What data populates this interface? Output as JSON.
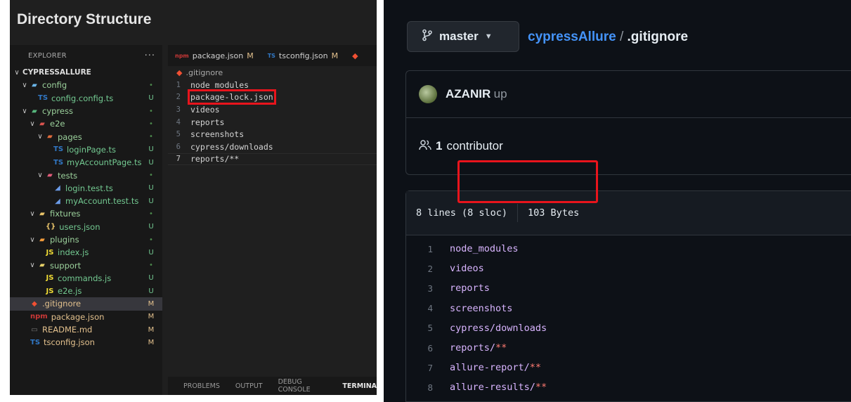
{
  "left": {
    "title": "Directory Structure",
    "explorer": {
      "header": "EXPLORER",
      "more": "···",
      "items": [
        {
          "name": "CYPRESSALLURE",
          "depth": 0,
          "chevron": "∨",
          "icon": "",
          "icon_name": "",
          "status": "",
          "kind": "root"
        },
        {
          "name": "config",
          "depth": 1,
          "chevron": "∨",
          "icon": "▰",
          "icon_name": "folder-config-icon",
          "status": "•",
          "kind": "folder"
        },
        {
          "name": "config.config.ts",
          "depth": 2,
          "chevron": "",
          "icon": "TS",
          "icon_name": "typescript-icon",
          "status": "U",
          "kind": "file"
        },
        {
          "name": "cypress",
          "depth": 1,
          "chevron": "∨",
          "icon": "▰",
          "icon_name": "folder-cypress-icon",
          "status": "•",
          "kind": "folder"
        },
        {
          "name": "e2e",
          "depth": 2,
          "chevron": "∨",
          "icon": "▰",
          "icon_name": "folder-e2e-icon",
          "status": "•",
          "kind": "folder"
        },
        {
          "name": "pages",
          "depth": 3,
          "chevron": "∨",
          "icon": "▰",
          "icon_name": "folder-pages-icon",
          "status": "•",
          "kind": "folder"
        },
        {
          "name": "loginPage.ts",
          "depth": 4,
          "chevron": "",
          "icon": "TS",
          "icon_name": "typescript-icon",
          "status": "U",
          "kind": "file"
        },
        {
          "name": "myAccountPage.ts",
          "depth": 4,
          "chevron": "",
          "icon": "TS",
          "icon_name": "typescript-icon",
          "status": "U",
          "kind": "file"
        },
        {
          "name": "tests",
          "depth": 3,
          "chevron": "∨",
          "icon": "▰",
          "icon_name": "folder-tests-icon",
          "status": "•",
          "kind": "folder"
        },
        {
          "name": "login.test.ts",
          "depth": 4,
          "chevron": "",
          "icon": "◢",
          "icon_name": "test-file-icon",
          "status": "U",
          "kind": "file"
        },
        {
          "name": "myAccount.test.ts",
          "depth": 4,
          "chevron": "",
          "icon": "◢",
          "icon_name": "test-file-icon",
          "status": "U",
          "kind": "file"
        },
        {
          "name": "fixtures",
          "depth": 2,
          "chevron": "∨",
          "icon": "▰",
          "icon_name": "folder-fixtures-icon",
          "status": "•",
          "kind": "folder"
        },
        {
          "name": "users.json",
          "depth": 3,
          "chevron": "",
          "icon": "{}",
          "icon_name": "json-icon",
          "status": "U",
          "kind": "file"
        },
        {
          "name": "plugins",
          "depth": 2,
          "chevron": "∨",
          "icon": "▰",
          "icon_name": "folder-plugins-icon",
          "status": "•",
          "kind": "folder"
        },
        {
          "name": "index.js",
          "depth": 3,
          "chevron": "",
          "icon": "JS",
          "icon_name": "javascript-icon",
          "status": "U",
          "kind": "file"
        },
        {
          "name": "support",
          "depth": 2,
          "chevron": "∨",
          "icon": "▰",
          "icon_name": "folder-support-icon",
          "status": "•",
          "kind": "folder"
        },
        {
          "name": "commands.js",
          "depth": 3,
          "chevron": "",
          "icon": "JS",
          "icon_name": "javascript-icon",
          "status": "U",
          "kind": "file"
        },
        {
          "name": "e2e.js",
          "depth": 3,
          "chevron": "",
          "icon": "JS",
          "icon_name": "javascript-icon",
          "status": "U",
          "kind": "file"
        },
        {
          "name": ".gitignore",
          "depth": 1,
          "chevron": "",
          "icon": "◆",
          "icon_name": "git-icon",
          "status": "M",
          "kind": "modified",
          "selected": true
        },
        {
          "name": "package.json",
          "depth": 1,
          "chevron": "",
          "icon": "npm",
          "icon_name": "npm-icon",
          "status": "M",
          "kind": "modified"
        },
        {
          "name": "README.md",
          "depth": 1,
          "chevron": "",
          "icon": "▭",
          "icon_name": "markdown-icon",
          "status": "M",
          "kind": "modified"
        },
        {
          "name": "tsconfig.json",
          "depth": 1,
          "chevron": "",
          "icon": "TS",
          "icon_name": "tsconfig-icon",
          "status": "M",
          "kind": "modified"
        }
      ]
    },
    "tabs": [
      {
        "label": "package.json",
        "status": "M",
        "icon": "npm",
        "icon_name": "npm-icon"
      },
      {
        "label": "tsconfig.json",
        "status": "M",
        "icon": "TS",
        "icon_name": "tsconfig-icon"
      }
    ],
    "breadcrumb": ".gitignore",
    "code_lines": [
      {
        "num": "1",
        "text": "node_modules"
      },
      {
        "num": "2",
        "text": "package-lock.json",
        "highlight": true
      },
      {
        "num": "3",
        "text": "videos"
      },
      {
        "num": "4",
        "text": "reports"
      },
      {
        "num": "5",
        "text": "screenshots"
      },
      {
        "num": "6",
        "text": "cypress/downloads"
      },
      {
        "num": "7",
        "text": "reports/**",
        "current": true
      }
    ],
    "panel_tabs": [
      "PROBLEMS",
      "OUTPUT",
      "DEBUG CONSOLE",
      "TERMINA"
    ]
  },
  "right": {
    "branch": "master",
    "repo": "cypressAllure",
    "separator": "/",
    "file": ".gitignore",
    "commit_author": "AZANIR",
    "commit_message": "up",
    "contributors_count": "1",
    "contributors_label": "contributor",
    "file_lines_info": "8 lines (8 sloc)",
    "file_size": "103 Bytes",
    "lines": [
      {
        "num": "1",
        "text": "node_modules",
        "stars": ""
      },
      {
        "num": "2",
        "text": "videos",
        "stars": ""
      },
      {
        "num": "3",
        "text": "reports",
        "stars": ""
      },
      {
        "num": "4",
        "text": "screenshots",
        "stars": ""
      },
      {
        "num": "5",
        "text": "cypress/downloads",
        "stars": ""
      },
      {
        "num": "6",
        "text": "reports/",
        "stars": "**"
      },
      {
        "num": "7",
        "text": "allure-report/",
        "stars": "**"
      },
      {
        "num": "8",
        "text": "allure-results/",
        "stars": "**"
      }
    ],
    "colors": {
      "link": "#4493f8",
      "highlight_box": "#e8141c",
      "code_text": "#d8b4fe",
      "asterisk": "#ff7b72"
    }
  }
}
